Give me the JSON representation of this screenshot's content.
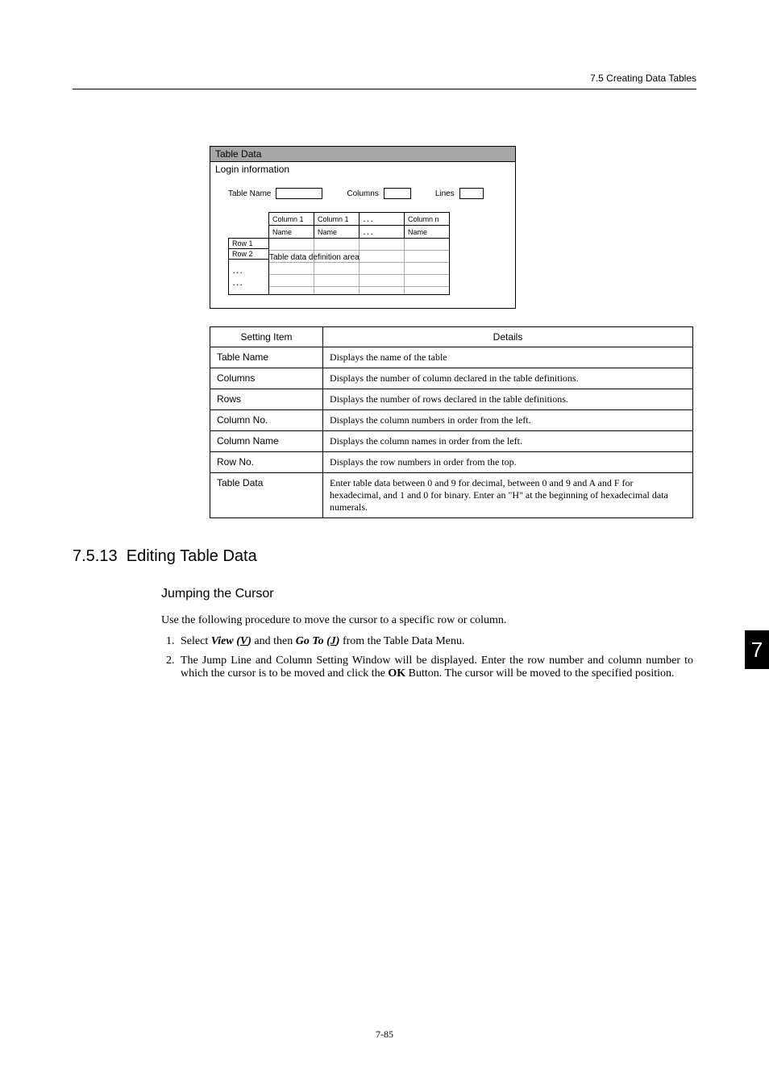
{
  "header": {
    "breadcrumb": "7.5  Creating Data Tables"
  },
  "diagram": {
    "title": "Table Data",
    "subtitle": "Login information",
    "labels": {
      "table_name": "Table Name",
      "columns": "Columns",
      "lines": "Lines"
    },
    "th": {
      "c1": "Column 1",
      "c2": "Column 1",
      "dots": "．．．",
      "cn": "Column n",
      "name": "Name"
    },
    "rows": {
      "r1": "Row 1",
      "r2": "Row 2",
      "dots": "．．．\n．．．"
    },
    "area": "Table data definition area"
  },
  "settings": {
    "headers": {
      "item": "Setting Item",
      "details": "Details"
    },
    "rows": [
      {
        "item": "Table Name",
        "details": "Displays the name of the table"
      },
      {
        "item": "Columns",
        "details": "Displays the number of column declared in the table definitions."
      },
      {
        "item": "Rows",
        "details": "Displays the number of rows declared in the table definitions."
      },
      {
        "item": "Column No.",
        "details": "Displays the column numbers in order from the left."
      },
      {
        "item": "Column Name",
        "details": "Displays the column names in order from the left."
      },
      {
        "item": "Row No.",
        "details": "Displays the row numbers in order from the top."
      },
      {
        "item": "Table Data",
        "details": "Enter table data between 0 and 9 for decimal, between 0 and 9 and A and F for hexadecimal, and 1 and 0 for binary. Enter an \"H\" at the beginning of hexadecimal data numerals."
      }
    ]
  },
  "section": {
    "num": "7.5.13",
    "title": "Editing Table Data"
  },
  "sub": {
    "title": "Jumping the Cursor"
  },
  "intro": "Use the following procedure to move the cursor to a specific row or column.",
  "steps": {
    "s1_a": "Select ",
    "s1_view": "View (V)",
    "s1_b": " and then ",
    "s1_goto": "Go To (J)",
    "s1_c": " from the Table Data Menu.",
    "s2_a": "The Jump Line and Column Setting Window will be displayed. Enter the row number and column number to which the cursor is to be moved and click the ",
    "s2_ok": "OK",
    "s2_b": " Button. The cursor will be moved to the specified position."
  },
  "sidetab": "7",
  "footer": "7-85"
}
